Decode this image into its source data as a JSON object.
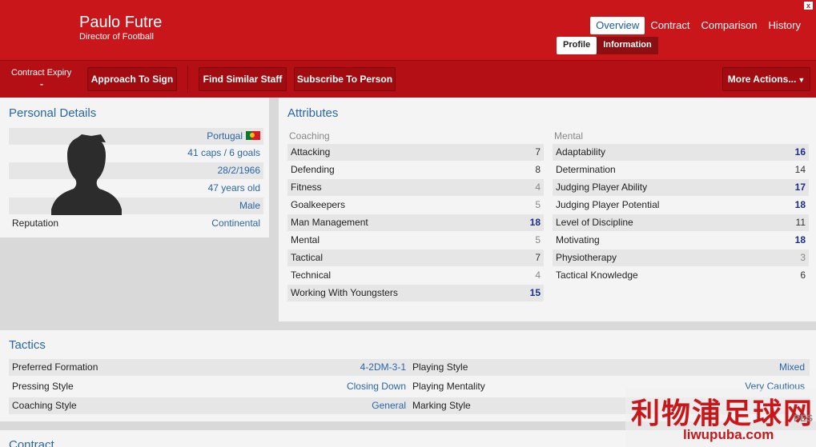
{
  "header": {
    "name": "Paulo Futre",
    "role": "Director of Football",
    "close_glyph": "x",
    "tabs": [
      {
        "label": "Overview",
        "active": true
      },
      {
        "label": "Contract",
        "active": false
      },
      {
        "label": "Comparison",
        "active": false
      },
      {
        "label": "History",
        "active": false
      }
    ],
    "sub_tabs": [
      {
        "label": "Profile",
        "active": true
      },
      {
        "label": "Information",
        "active": false
      }
    ]
  },
  "toolbar": {
    "contract_expiry_label": "Contract Expiry",
    "contract_expiry_value": "-",
    "approach_label": "Approach To Sign",
    "find_similar_label": "Find Similar Staff",
    "subscribe_label": "Subscribe To Person",
    "more_actions_label": "More Actions..."
  },
  "personal": {
    "title": "Personal Details",
    "nationality": "Portugal",
    "caps": "41 caps / 6 goals",
    "dob": "28/2/1966",
    "age": "47 years old",
    "gender": "Male",
    "reputation_label": "Reputation",
    "reputation": "Continental"
  },
  "attributes": {
    "title": "Attributes",
    "coaching_head": "Coaching",
    "mental_head": "Mental",
    "coaching": [
      {
        "label": "Attacking",
        "value": "7",
        "tier": "dark"
      },
      {
        "label": "Defending",
        "value": "8",
        "tier": "dark"
      },
      {
        "label": "Fitness",
        "value": "4",
        "tier": "grey"
      },
      {
        "label": "Goalkeepers",
        "value": "5",
        "tier": "grey"
      },
      {
        "label": "Man Management",
        "value": "18",
        "tier": "bold"
      },
      {
        "label": "Mental",
        "value": "5",
        "tier": "grey"
      },
      {
        "label": "Tactical",
        "value": "7",
        "tier": "dark"
      },
      {
        "label": "Technical",
        "value": "4",
        "tier": "grey"
      },
      {
        "label": "Working With Youngsters",
        "value": "15",
        "tier": "bold"
      }
    ],
    "mental": [
      {
        "label": "Adaptability",
        "value": "16",
        "tier": "bold"
      },
      {
        "label": "Determination",
        "value": "14",
        "tier": "dark"
      },
      {
        "label": "Judging Player Ability",
        "value": "17",
        "tier": "bold"
      },
      {
        "label": "Judging Player Potential",
        "value": "18",
        "tier": "bold"
      },
      {
        "label": "Level of Discipline",
        "value": "11",
        "tier": "dark"
      },
      {
        "label": "Motivating",
        "value": "18",
        "tier": "bold"
      },
      {
        "label": "Physiotherapy",
        "value": "3",
        "tier": "grey"
      },
      {
        "label": "Tactical Knowledge",
        "value": "6",
        "tier": "dark"
      }
    ]
  },
  "tactics": {
    "title": "Tactics",
    "rows": [
      {
        "l1": "Preferred Formation",
        "v1": "4-2DM-3-1",
        "l2": "Playing Style",
        "v2": "Mixed"
      },
      {
        "l1": "Pressing Style",
        "v1": "Closing Down",
        "l2": "Playing Mentality",
        "v2": "Very Cautious"
      },
      {
        "l1": "Coaching Style",
        "v1": "General",
        "l2": "Marking Style",
        "v2": ""
      }
    ]
  },
  "contract": {
    "title": "Contract"
  },
  "watermark": {
    "cn": "利物浦足球网",
    "url": "liwupuba.com",
    "corner": "PES"
  },
  "colors": {
    "brand_red": "#c8161b",
    "link_blue": "#2a66a8",
    "strong_value": "#1b2f8a"
  }
}
